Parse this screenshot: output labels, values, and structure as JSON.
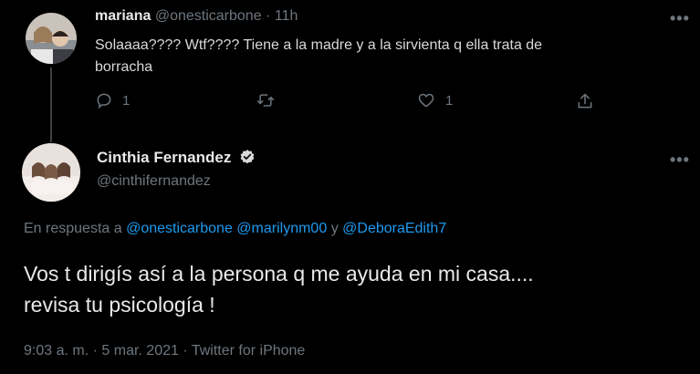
{
  "reply_tweet": {
    "display_name": "mariana",
    "handle": "@onesticarbone",
    "separator": "·",
    "time_ago": "11h",
    "text_line1": "Solaaaa???? Wtf???? Tiene a la madre y a la sirvienta q ella trata de",
    "text_line2": "borracha",
    "actions": {
      "reply_count": "1",
      "retweet_count": "",
      "like_count": "1"
    }
  },
  "main_tweet": {
    "display_name": "Cinthia Fernandez",
    "handle": "@cinthifernandez",
    "reply_prefix": "En respuesta a",
    "mention_1": "@onesticarbone",
    "mention_2": "@marilynm00",
    "mention_join": "y",
    "mention_3": "@DeboraEdith7",
    "text_line1": "Vos t dirigís así a la persona q me ayuda en mi casa....",
    "text_line2": "revisa tu psicología !",
    "meta_time": "9:03 a. m.",
    "meta_sep1": "·",
    "meta_date": "5 mar. 2021",
    "meta_sep2": "·",
    "meta_source": "Twitter for iPhone"
  },
  "more_label": "•••",
  "icons": [
    "reply-icon",
    "retweet-icon",
    "like-icon",
    "share-icon",
    "verified-badge-icon",
    "more-options-icon"
  ],
  "colors": {
    "background": "#000000",
    "link": "#1d9bf0",
    "muted": "#6e767d",
    "text": "#d9d9d9"
  }
}
